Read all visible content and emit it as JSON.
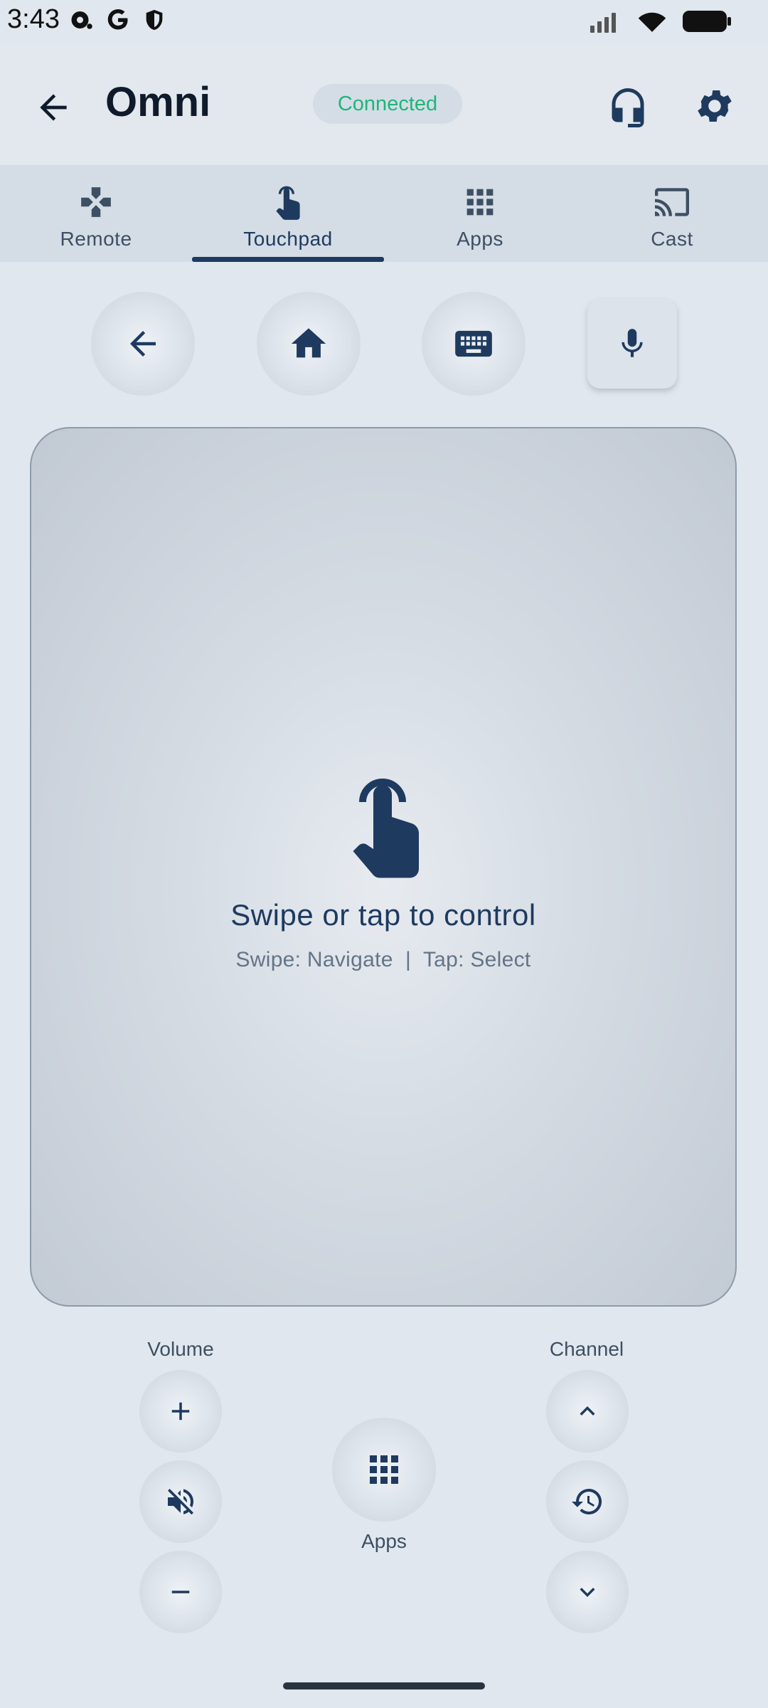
{
  "status_bar": {
    "time": "3:43"
  },
  "app_bar": {
    "title": "Omni",
    "connection_status": "Connected",
    "status_color": "#1fb57a"
  },
  "tabs": [
    {
      "label": "Remote",
      "icon": "gamepad-icon",
      "active": false
    },
    {
      "label": "Touchpad",
      "icon": "touch-icon",
      "active": true
    },
    {
      "label": "Apps",
      "icon": "apps-grid-icon",
      "active": false
    },
    {
      "label": "Cast",
      "icon": "cast-icon",
      "active": false
    }
  ],
  "quick_buttons": [
    "back-icon",
    "home-icon",
    "keyboard-icon",
    "mic-icon"
  ],
  "touchpad": {
    "title": "Swipe or tap to control",
    "hint": "Swipe: Navigate  |  Tap: Select"
  },
  "controls": {
    "volume_label": "Volume",
    "channel_label": "Channel",
    "apps_label": "Apps"
  },
  "colors": {
    "primary": "#1e3a5f",
    "background": "#e1e7ee"
  }
}
